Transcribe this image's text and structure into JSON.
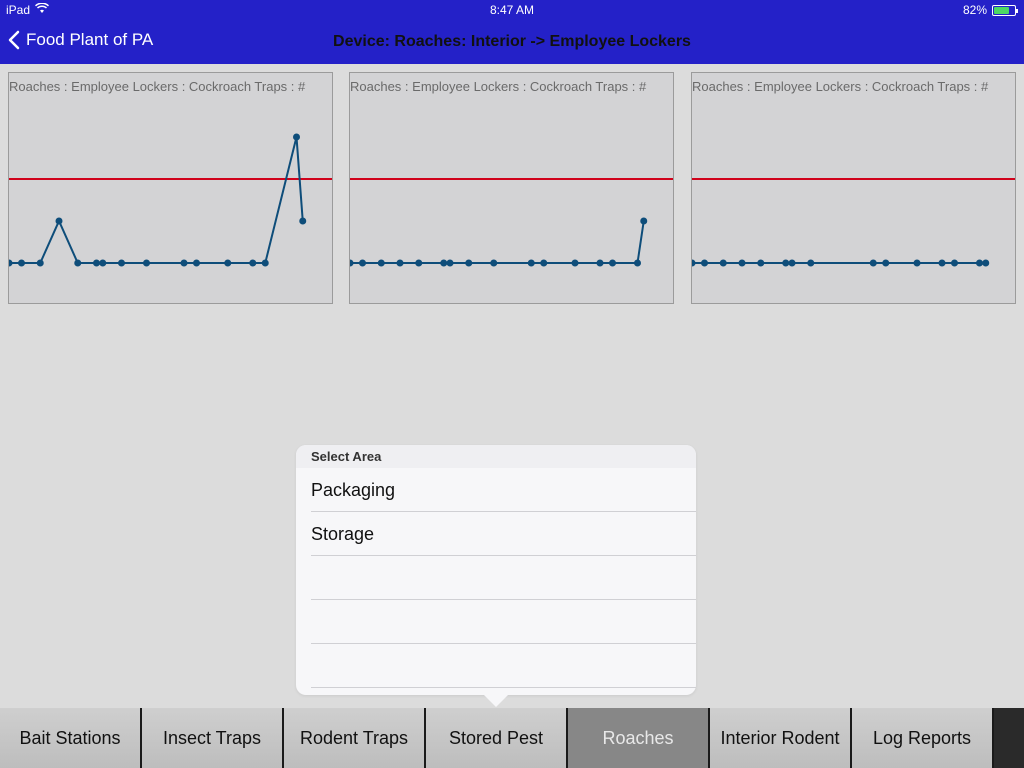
{
  "status_bar": {
    "device": "iPad",
    "time": "8:47 AM",
    "battery": "82%",
    "battery_level": 0.82,
    "wifi_icon": "wifi-icon",
    "battery_icon": "battery-icon"
  },
  "nav": {
    "back_label": "Food Plant of PA",
    "title": "Device: Roaches: Interior -> Employee Lockers"
  },
  "colors": {
    "nav_bg": "#2421c8",
    "threshold": "#d0021b",
    "series": "#0e4d7a",
    "active_tab": "#878787"
  },
  "chart_data": [
    {
      "type": "line",
      "title": "Roaches : Employee Lockers : Cockroach Traps : #",
      "threshold": 2,
      "ylim": [
        -1,
        4
      ],
      "x": [
        0,
        2,
        5,
        8,
        11,
        14,
        15,
        18,
        22,
        28,
        30,
        35,
        39,
        41,
        46,
        47
      ],
      "values": [
        0,
        0,
        0,
        1,
        0,
        0,
        0,
        0,
        0,
        0,
        0,
        0,
        0,
        0,
        3,
        1
      ]
    },
    {
      "type": "line",
      "title": "Roaches : Employee Lockers : Cockroach Traps : #",
      "threshold": 2,
      "ylim": [
        -1,
        4
      ],
      "x": [
        0,
        2,
        5,
        8,
        11,
        15,
        16,
        19,
        23,
        29,
        31,
        36,
        40,
        42,
        46,
        47
      ],
      "values": [
        0,
        0,
        0,
        0,
        0,
        0,
        0,
        0,
        0,
        0,
        0,
        0,
        0,
        0,
        0,
        1
      ]
    },
    {
      "type": "line",
      "title": "Roaches : Employee Lockers : Cockroach Traps : #",
      "threshold": 2,
      "ylim": [
        -1,
        4
      ],
      "x": [
        0,
        2,
        5,
        8,
        11,
        15,
        16,
        19,
        29,
        31,
        36,
        40,
        42,
        46,
        47
      ],
      "values": [
        0,
        0,
        0,
        0,
        0,
        0,
        0,
        0,
        0,
        0,
        0,
        0,
        0,
        0,
        0
      ]
    }
  ],
  "popover": {
    "header": "Select Area",
    "items": [
      "Packaging",
      "Storage",
      "",
      "",
      ""
    ]
  },
  "tabs": [
    {
      "label": "Bait Stations",
      "active": false
    },
    {
      "label": "Insect Traps",
      "active": false
    },
    {
      "label": "Rodent Traps",
      "active": false
    },
    {
      "label": "Stored Pest",
      "active": false
    },
    {
      "label": "Roaches",
      "active": true
    },
    {
      "label": "Interior Rodent",
      "active": false
    },
    {
      "label": "Log Reports",
      "active": false
    }
  ]
}
